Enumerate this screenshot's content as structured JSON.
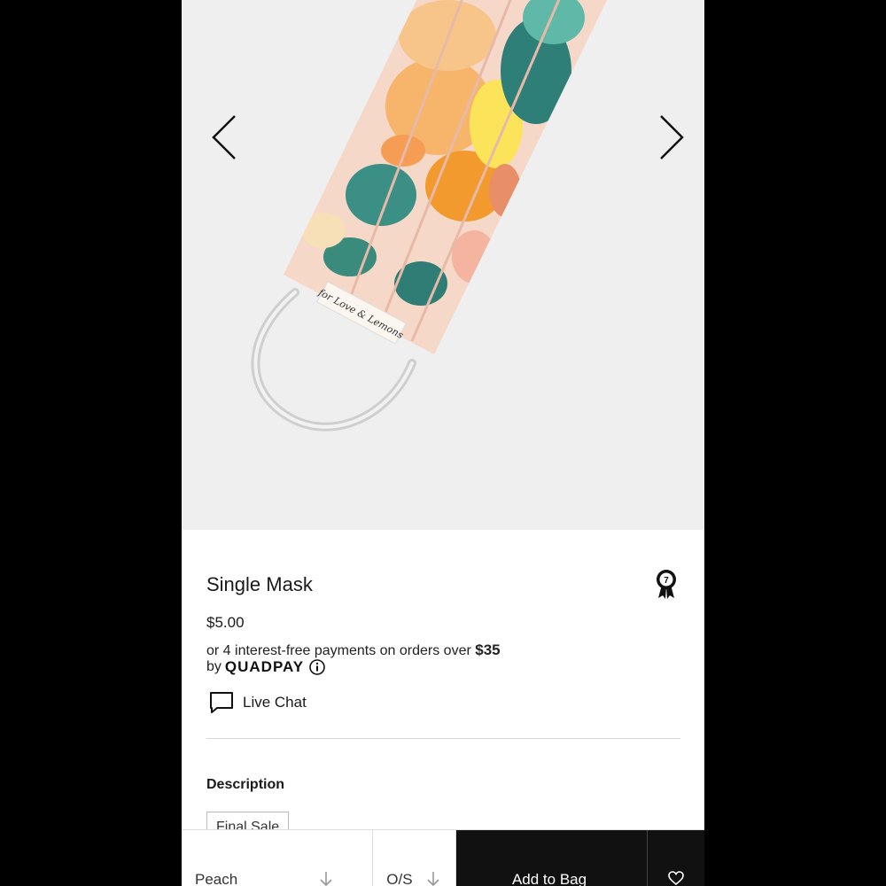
{
  "gallery": {
    "prev_icon": "chevron-left-icon",
    "next_icon": "chevron-right-icon",
    "image_label_text": "for Love & Lemons"
  },
  "product": {
    "title": "Single Mask",
    "badge_icon": "award-ribbon-icon",
    "price": "$5.00",
    "installments_text": "or 4 interest-free payments on orders over",
    "installments_amount": "$35",
    "by_text": "by",
    "provider": "QUADPAY",
    "live_chat_label": "Live Chat",
    "description_heading": "Description",
    "final_sale_tag": "Final Sale"
  },
  "bottom_bar": {
    "color_value": "Peach",
    "size_value": "O/S",
    "add_to_bag_label": "Add to Bag",
    "wishlist_icon": "heart-icon"
  },
  "colors": {
    "accent_dark": "#111111",
    "gallery_bg": "#efefef"
  }
}
